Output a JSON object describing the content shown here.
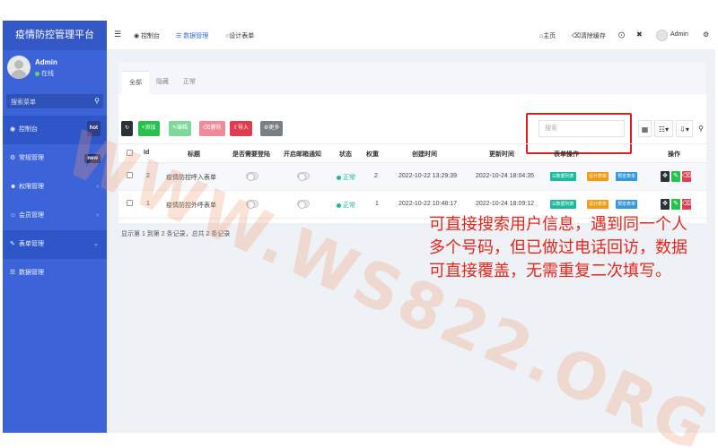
{
  "app": {
    "title": "疫情防控管理平台"
  },
  "user": {
    "name": "Admin",
    "status": "在线"
  },
  "sidebar": {
    "search_placeholder": "搜索菜单",
    "items": [
      {
        "label": "控制台",
        "badge": "hot"
      },
      {
        "label": "常规管理",
        "badge": "new"
      },
      {
        "label": "权限管理"
      },
      {
        "label": "会员管理"
      },
      {
        "label": "表单管理"
      },
      {
        "label": "数据管理"
      }
    ]
  },
  "topnav": {
    "tabs": [
      "控制台",
      "数据管理",
      "设计表单"
    ],
    "right": {
      "home": "主页",
      "clear_cache": "清除缓存",
      "user": "Admin"
    }
  },
  "tabs": [
    "全部",
    "隐藏",
    "正常"
  ],
  "toolbar": {
    "add": "添加",
    "edit": "编辑",
    "delete": "删除",
    "import": "导入",
    "more": "更多"
  },
  "search": {
    "placeholder": "搜索"
  },
  "table": {
    "columns": [
      "Id",
      "标题",
      "是否需要登陆",
      "开启邮箱通知",
      "状态",
      "权重",
      "创建时间",
      "更新时间",
      "表单操作",
      "操作"
    ],
    "rows": [
      {
        "id": "2",
        "title": "疫情防控呼入表单",
        "status": "正常",
        "weight": "2",
        "created": "2022-10-22 13:29:39",
        "updated": "2022-10-24 18:04:35"
      },
      {
        "id": "1",
        "title": "疫情防控外呼表单",
        "status": "正常",
        "weight": "1",
        "created": "2022-10-22 10:48:17",
        "updated": "2022-10-24 18:09:12"
      }
    ],
    "form_actions": [
      "数据列表",
      "设计表单",
      "预览表单"
    ]
  },
  "footer": {
    "summary": "显示第 1 到第 2 条记录，总共 2 条记录"
  },
  "annotation": {
    "text": "可直接搜索用户信息，遇到同一个人多个号码，但已做过电话回访，数据可直接覆盖，无需重复二次填写。"
  },
  "watermark": {
    "text": "WWW.WS822.ORG"
  }
}
